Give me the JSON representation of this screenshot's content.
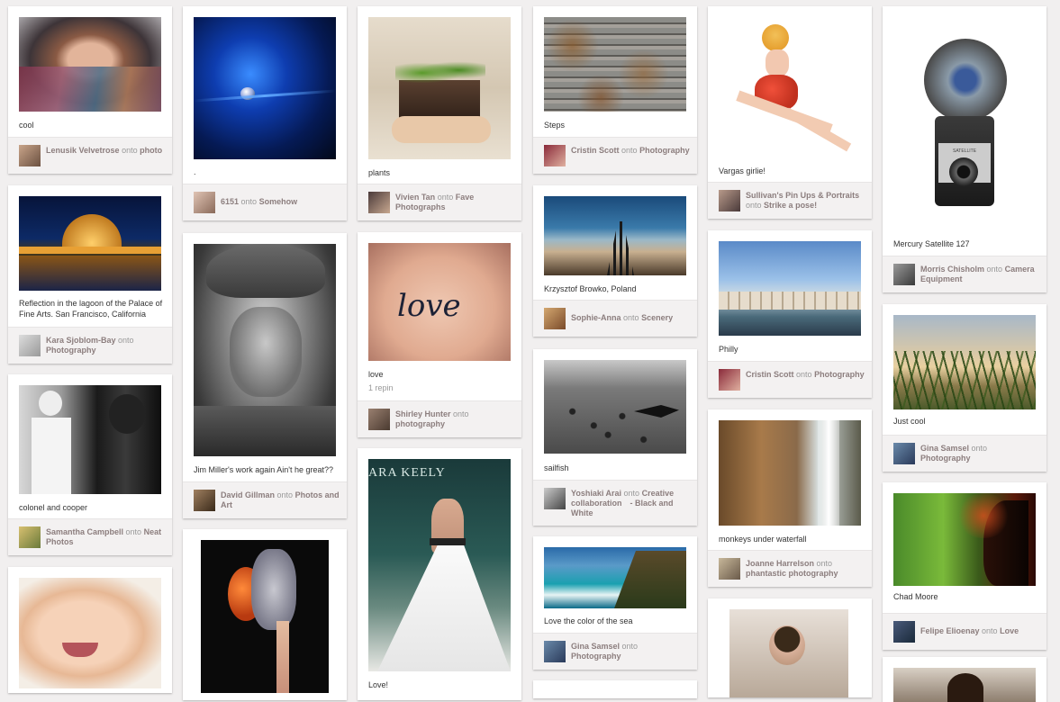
{
  "onto": "onto",
  "pins": [
    {
      "caption": "cool",
      "user": "Lenusik Velvetrose",
      "board": "photo"
    },
    {
      "caption": "Reflection in the lagoon of the Palace of Fine Arts. San Francisco, California",
      "user": "Kara Sjoblom-Bay",
      "board": "Photography"
    },
    {
      "caption": "colonel and cooper",
      "user": "Samantha Campbell",
      "board": "Neat Photos"
    },
    {
      "caption": ".",
      "user": "6151",
      "board": "Somehow"
    },
    {
      "caption": "Jim Miller's work again Ain't he great??",
      "user": "David Gillman",
      "board": "Photos and Art"
    },
    {
      "caption": "plants",
      "user": "Vivien Tan",
      "board": "Fave Photographs"
    },
    {
      "caption": "love",
      "repins": "1 repin",
      "user": "Shirley Hunter",
      "board": "photography"
    },
    {
      "caption": "Love!"
    },
    {
      "caption": "Steps",
      "user": "Cristin Scott",
      "board": "Photography"
    },
    {
      "caption": "Krzysztof Browko, Poland",
      "user": "Sophie-Anna",
      "board": "Scenery"
    },
    {
      "caption": "sailfish",
      "user": "Yoshiaki Arai",
      "board": "Creative collaboration　- Black and White"
    },
    {
      "caption": "Love the color of the sea",
      "user": "Gina Samsel",
      "board": "Photography"
    },
    {
      "caption": "Vargas girlie!",
      "user": "Sullivan's Pin Ups & Portraits",
      "board": "Strike a pose!"
    },
    {
      "caption": "Philly",
      "user": "Cristin Scott",
      "board": "Photography"
    },
    {
      "caption": "monkeys under waterfall",
      "user": "Joanne Harrelson",
      "board": "phantastic photography"
    },
    {
      "caption": "Mercury Satellite 127",
      "user": "Morris Chisholm",
      "board": "Camera Equipment"
    },
    {
      "caption": "Just cool",
      "user": "Gina Samsel",
      "board": "Photography"
    },
    {
      "caption": "Chad Moore",
      "user": "Felipe Elioenay",
      "board": "Love"
    }
  ],
  "image_text": {
    "camera_logo": "SATELLITE",
    "dress_banner": "ARA KEELY"
  }
}
